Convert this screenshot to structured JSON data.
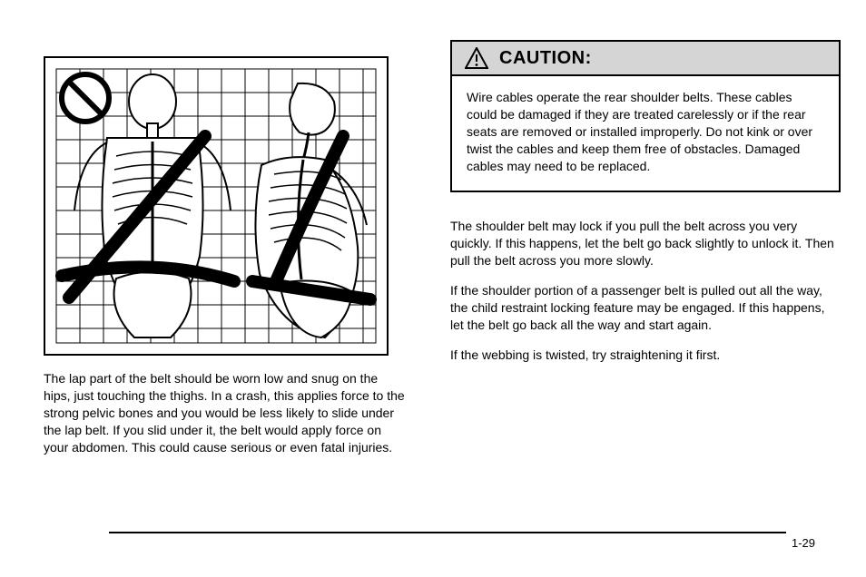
{
  "figure": {
    "alt": "Incorrect safety belt position over abdomen — skeleton front and side views with prohibition symbol"
  },
  "left_paragraph": "The lap part of the belt should be worn low and snug on the hips, just touching the thighs. In a crash, this applies force to the strong pelvic bones and you would be less likely to slide under the lap belt. If you slid under it, the belt would apply force on your abdomen. This could cause serious or even fatal injuries.",
  "caution": {
    "title": "CAUTION:",
    "body": "Wire cables operate the rear shoulder belts. These cables could be damaged if they are treated carelessly or if the rear seats are removed or installed improperly. Do not kink or over twist the cables and keep them free of obstacles. Damaged cables may need to be replaced."
  },
  "right_paragraphs": [
    "The shoulder belt may lock if you pull the belt across you very quickly. If this happens, let the belt go back slightly to unlock it. Then pull the belt across you more slowly.",
    "If the shoulder portion of a passenger belt is pulled out all the way, the child restraint locking feature may be engaged. If this happens, let the belt go back all the way and start again.",
    "If the webbing is twisted, try straightening it first."
  ],
  "page_number": "1-29"
}
